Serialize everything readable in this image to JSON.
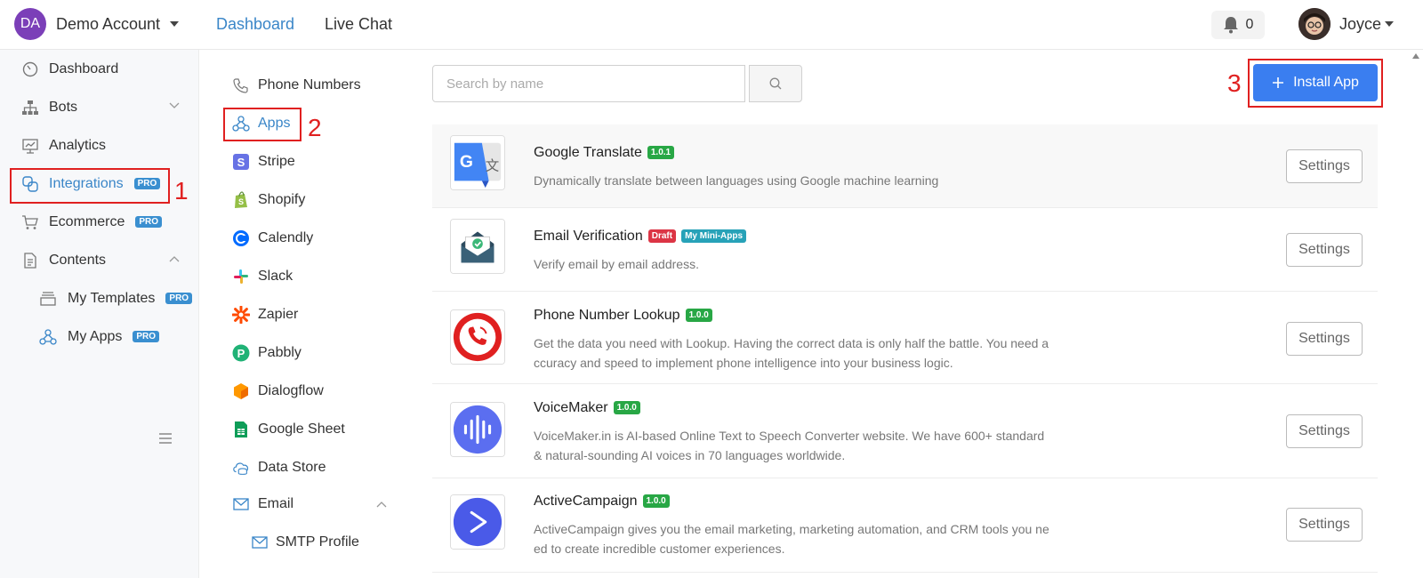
{
  "header": {
    "account_initials": "DA",
    "account_name": "Demo Account",
    "nav": [
      "Dashboard",
      "Live Chat"
    ],
    "notifications_count": "0",
    "user_name": "Joyce"
  },
  "sidebar": {
    "items": [
      {
        "label": "Dashboard"
      },
      {
        "label": "Bots"
      },
      {
        "label": "Analytics"
      },
      {
        "label": "Integrations",
        "badge": "PRO"
      },
      {
        "label": "Ecommerce",
        "badge": "PRO"
      },
      {
        "label": "Contents"
      },
      {
        "label": "My Templates",
        "badge": "PRO"
      },
      {
        "label": "My Apps",
        "badge": "PRO"
      }
    ]
  },
  "integrations_menu": {
    "items": [
      {
        "label": "Phone Numbers"
      },
      {
        "label": "Apps"
      },
      {
        "label": "Stripe"
      },
      {
        "label": "Shopify"
      },
      {
        "label": "Calendly"
      },
      {
        "label": "Slack"
      },
      {
        "label": "Zapier"
      },
      {
        "label": "Pabbly"
      },
      {
        "label": "Dialogflow"
      },
      {
        "label": "Google Sheet"
      },
      {
        "label": "Data Store"
      },
      {
        "label": "Email"
      },
      {
        "label": "SMTP Profile"
      }
    ]
  },
  "annotations": [
    "1",
    "2",
    "3"
  ],
  "search": {
    "placeholder": "Search by name"
  },
  "install_button": "Install App",
  "settings_label": "Settings",
  "apps": [
    {
      "name": "Google Translate",
      "badges": [
        "1.0.1"
      ],
      "desc": "Dynamically translate between languages using Google machine learning"
    },
    {
      "name": "Email Verification",
      "badges": [
        "Draft",
        "My Mini-Apps"
      ],
      "desc": "Verify email by email address."
    },
    {
      "name": "Phone Number Lookup",
      "badges": [
        "1.0.0"
      ],
      "desc": "Get the data you need with Lookup. Having the correct data is only half the battle. You need accuracy and speed to implement phone intelligence into your business logic."
    },
    {
      "name": "VoiceMaker",
      "badges": [
        "1.0.0"
      ],
      "desc": "VoiceMaker.in is AI-based Online Text to Speech Converter website. We have 600+ standard & natural-sounding AI voices in 70 languages worldwide."
    },
    {
      "name": "ActiveCampaign",
      "badges": [
        "1.0.0"
      ],
      "desc": "ActiveCampaign gives you the email marketing, marketing automation, and CRM tools you need to create incredible customer experiences."
    }
  ],
  "colors": {
    "accent": "#3a7ef0",
    "link": "#3a86c8",
    "highlight": "#e02020",
    "pro_badge": "#3a8fd0"
  }
}
